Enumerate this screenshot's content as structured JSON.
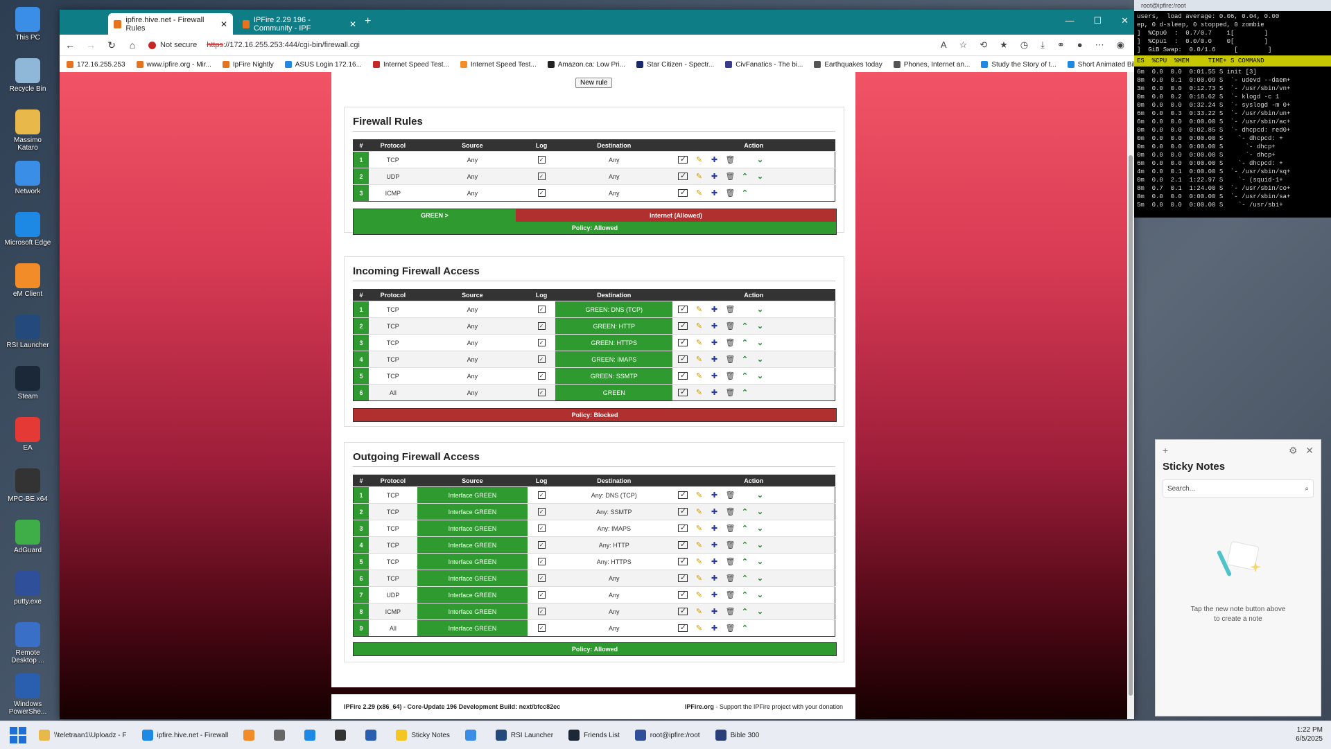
{
  "desktop": {
    "icons": [
      {
        "label": "This PC",
        "color": "#3a8ee6"
      },
      {
        "label": "Recycle Bin",
        "color": "#8fb7d8"
      },
      {
        "label": "Massimo Kataro",
        "color": "#e9b84a"
      },
      {
        "label": "Network",
        "color": "#3a8ee6"
      },
      {
        "label": "Microsoft Edge",
        "color": "#1e88e5"
      },
      {
        "label": "eM Client",
        "color": "#f28c28"
      },
      {
        "label": "RSI Launcher",
        "color": "#234a7a"
      },
      {
        "label": "Steam",
        "color": "#1b2838"
      },
      {
        "label": "EA",
        "color": "#e53935"
      },
      {
        "label": "MPC-BE x64",
        "color": "#333"
      },
      {
        "label": "AdGuard",
        "color": "#3fae49"
      },
      {
        "label": "putty.exe",
        "color": "#2f4f9a"
      },
      {
        "label": "Remote Desktop ...",
        "color": "#3a6fc8"
      },
      {
        "label": "Windows PowerShe...",
        "color": "#2a5fb0"
      }
    ]
  },
  "browser": {
    "tabs": [
      {
        "title": "ipfire.hive.net - Firewall Rules",
        "active": true
      },
      {
        "title": "IPFire 2.29 196 - Community - IPF",
        "active": false
      }
    ],
    "address": {
      "not_secure": "Not secure",
      "url_scheme": "https",
      "url_rest": "://172.16.255.253:444/cgi-bin/firewall.cgi"
    },
    "favorites": [
      "172.16.255.253",
      "www.ipfire.org - Mir...",
      "IpFire Nightly",
      "ASUS Login 172.16...",
      "Internet Speed Test...",
      "Internet Speed Test...",
      "Amazon.ca: Low Pri...",
      "Star Citizen - Spectr...",
      "CivFanatics - The bi...",
      "Earthquakes today",
      "Phones, Internet an...",
      "Study the Story of t...",
      "Short Animated Bibl..."
    ]
  },
  "page": {
    "new_rule": "New rule",
    "headers": {
      "num": "#",
      "protocol": "Protocol",
      "source": "Source",
      "log": "Log",
      "destination": "Destination",
      "action": "Action"
    },
    "firewall_rules": {
      "title": "Firewall Rules",
      "rows": [
        {
          "num": "1",
          "protocol": "TCP",
          "source": "Any",
          "destination": "Any",
          "up": false,
          "down": true
        },
        {
          "num": "2",
          "protocol": "UDP",
          "source": "Any",
          "destination": "Any",
          "up": true,
          "down": true
        },
        {
          "num": "3",
          "protocol": "ICMP",
          "source": "Any",
          "destination": "Any",
          "up": true,
          "down": false
        }
      ],
      "policy_left": "GREEN >",
      "policy_right": "Internet (Allowed)",
      "policy": "Policy: Allowed"
    },
    "incoming": {
      "title": "Incoming Firewall Access",
      "rows": [
        {
          "num": "1",
          "protocol": "TCP",
          "source": "Any",
          "destination": "GREEN: DNS (TCP)",
          "up": false,
          "down": true
        },
        {
          "num": "2",
          "protocol": "TCP",
          "source": "Any",
          "destination": "GREEN: HTTP",
          "up": true,
          "down": true
        },
        {
          "num": "3",
          "protocol": "TCP",
          "source": "Any",
          "destination": "GREEN: HTTPS",
          "up": true,
          "down": true
        },
        {
          "num": "4",
          "protocol": "TCP",
          "source": "Any",
          "destination": "GREEN: IMAPS",
          "up": true,
          "down": true
        },
        {
          "num": "5",
          "protocol": "TCP",
          "source": "Any",
          "destination": "GREEN: SSMTP",
          "up": true,
          "down": true
        },
        {
          "num": "6",
          "protocol": "All",
          "source": "Any",
          "destination": "GREEN",
          "up": true,
          "down": false
        }
      ],
      "policy": "Policy: Blocked"
    },
    "outgoing": {
      "title": "Outgoing Firewall Access",
      "rows": [
        {
          "num": "1",
          "protocol": "TCP",
          "source": "Interface GREEN",
          "destination": "Any: DNS (TCP)",
          "up": false,
          "down": true
        },
        {
          "num": "2",
          "protocol": "TCP",
          "source": "Interface GREEN",
          "destination": "Any: SSMTP",
          "up": true,
          "down": true
        },
        {
          "num": "3",
          "protocol": "TCP",
          "source": "Interface GREEN",
          "destination": "Any: IMAPS",
          "up": true,
          "down": true
        },
        {
          "num": "4",
          "protocol": "TCP",
          "source": "Interface GREEN",
          "destination": "Any: HTTP",
          "up": true,
          "down": true
        },
        {
          "num": "5",
          "protocol": "TCP",
          "source": "Interface GREEN",
          "destination": "Any: HTTPS",
          "up": true,
          "down": true
        },
        {
          "num": "6",
          "protocol": "TCP",
          "source": "Interface GREEN",
          "destination": "Any",
          "up": true,
          "down": true
        },
        {
          "num": "7",
          "protocol": "UDP",
          "source": "Interface GREEN",
          "destination": "Any",
          "up": true,
          "down": true
        },
        {
          "num": "8",
          "protocol": "ICMP",
          "source": "Interface GREEN",
          "destination": "Any",
          "up": true,
          "down": true
        },
        {
          "num": "9",
          "protocol": "All",
          "source": "Interface GREEN",
          "destination": "Any",
          "up": true,
          "down": false
        }
      ],
      "policy": "Policy: Allowed"
    },
    "footer_left": "IPFire 2.29 (x86_64) - Core-Update 196 Development Build: next/bfcc82ec",
    "footer_brand": "IPFire.org",
    "footer_right": " - Support the IPFire project with your donation"
  },
  "terminal": {
    "title": "root@ipfire:/root",
    "lines": [
      "users,  load average: 0.06, 0.04, 0.00",
      "ep, 0 d-sleep, 0 stopped, 0 zombie",
      "]  %Cpu0  :  0.7/0.7    1[        ]",
      "]  %Cpu1  :  0.0/0.0    0[        ]",
      "]  GiB Swap:  0.0/1.6     [        ]"
    ],
    "header": "ES  %CPU  %MEM     TIME+ S COMMAND",
    "rows": [
      "6m  0.0  0.0  0:01.55 S init [3]",
      "8m  0.0  0.1  0:00.09 S  `- udevd --daem+",
      "3m  0.0  0.0  0:12.73 S  `- /usr/sbin/vn+",
      "0m  0.0  0.2  0:18.62 S  `- klogd -c 1",
      "0m  0.0  0.0  0:32.24 S  `- syslogd -m 0+",
      "6m  0.0  0.3  0:33.22 S  `- /usr/sbin/un+",
      "6m  0.0  0.0  0:00.00 S  `- /usr/sbin/ac+",
      "0m  0.0  0.0  0:02.85 S  `- dhcpcd: red0+",
      "0m  0.0  0.0  0:00.00 S    `- dhcpcd: +",
      "0m  0.0  0.0  0:00.00 S      `- dhcp+",
      "0m  0.0  0.0  0:00.00 S      `- dhcp+",
      "6m  0.0  0.0  0:00.00 S    `- dhcpcd: +",
      "4m  0.0  0.1  0:00.00 S  `- /usr/sbin/sq+",
      "0m  0.0  2.1  1:22.97 S    `- (squid-1+",
      "8m  0.7  0.1  1:24.00 S  `- /usr/sbin/co+",
      "8m  0.0  0.0  0:00.00 S  `- /usr/sbin/sa+",
      "5m  0.0  0.0  0:00.00 S    `- /usr/sbi+"
    ]
  },
  "sticky": {
    "title": "Sticky Notes",
    "search_placeholder": "Search...",
    "empty_line1": "Tap the new note button above",
    "empty_line2": "to create a note"
  },
  "taskbar": {
    "items": [
      {
        "label": "\\\\teletraan1\\Uploadz - F",
        "color": "#e9b84a"
      },
      {
        "label": "ipfire.hive.net - Firewall",
        "color": "#1e88e5"
      },
      {
        "label": "",
        "color": "#f28c28"
      },
      {
        "label": "",
        "color": "#666"
      },
      {
        "label": "",
        "color": "#1e88e5"
      },
      {
        "label": "",
        "color": "#333"
      },
      {
        "label": "",
        "color": "#2a5fb0"
      },
      {
        "label": "Sticky Notes",
        "color": "#f3c623"
      },
      {
        "label": "",
        "color": "#3a8ee6"
      },
      {
        "label": "RSI Launcher",
        "color": "#234a7a"
      },
      {
        "label": "Friends List",
        "color": "#1b2838"
      },
      {
        "label": "root@ipfire:/root",
        "color": "#2f4f9a"
      },
      {
        "label": "Bible 300",
        "color": "#2a3f7a"
      }
    ],
    "time": "1:22 PM",
    "date": "6/5/2025"
  }
}
